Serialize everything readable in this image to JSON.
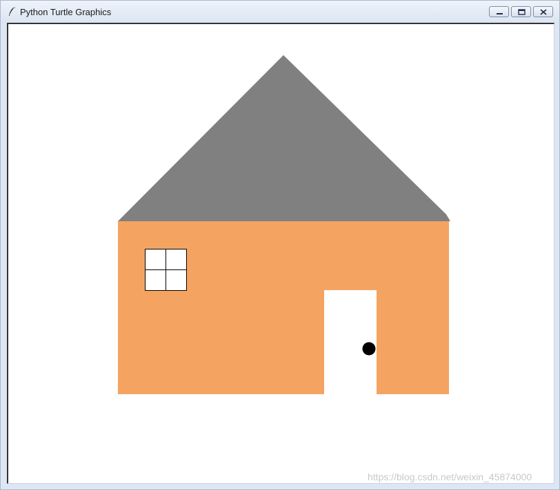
{
  "window": {
    "title": "Python Turtle Graphics",
    "icon": "feather-pen-icon",
    "controls": {
      "minimize": "minimize-icon",
      "maximize": "maximize-icon",
      "close": "close-icon"
    }
  },
  "canvas": {
    "background": "#ffffff",
    "roof_color": "#808080",
    "wall_color": "#f4a460",
    "window_fill": "#ffffff",
    "window_stroke": "#000000",
    "door_color": "#ffffff",
    "knob_color": "#000000"
  },
  "watermark": "https://blog.csdn.net/weixin_45874000"
}
